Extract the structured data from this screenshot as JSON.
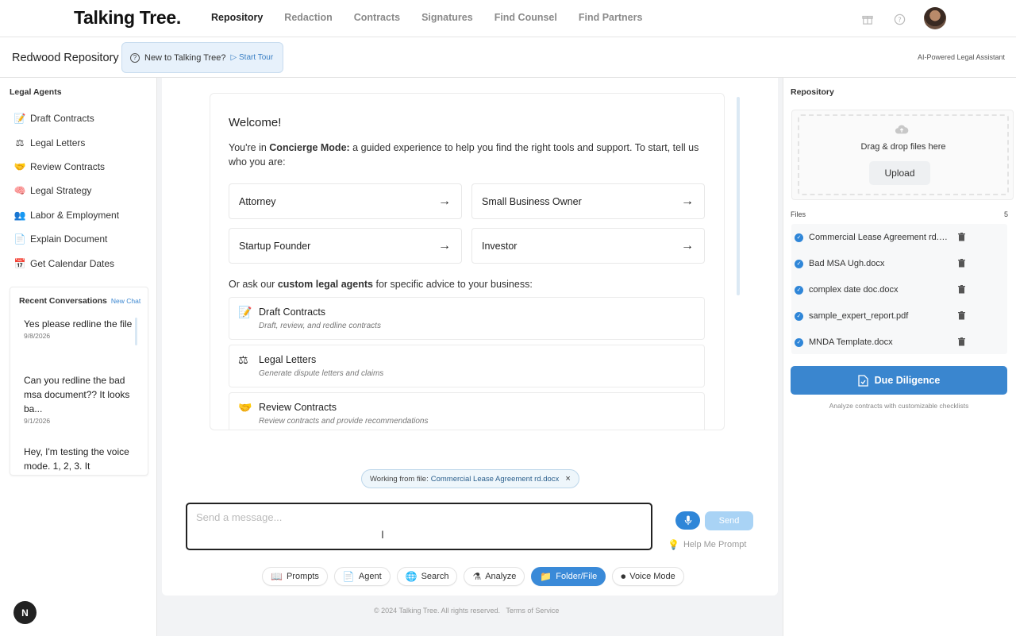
{
  "app": {
    "logo": "Talking Tree."
  },
  "nav": {
    "items": [
      {
        "label": "Repository",
        "active": true
      },
      {
        "label": "Redaction",
        "active": false
      },
      {
        "label": "Contracts",
        "active": false
      },
      {
        "label": "Signatures",
        "active": false
      },
      {
        "label": "Find Counsel",
        "active": false
      },
      {
        "label": "Find Partners",
        "active": false
      }
    ],
    "icons": [
      "gift-icon",
      "help-circle-icon",
      "user-avatar"
    ]
  },
  "subheader": {
    "title": "Redwood Repository",
    "tour_text": "New to Talking Tree?",
    "tour_link": "Start Tour",
    "assistant_label": "AI-Powered Legal Assistant"
  },
  "left": {
    "agents_title": "Legal Agents",
    "agents": [
      {
        "icon": "📝",
        "label": "Draft Contracts"
      },
      {
        "icon": "⚖",
        "label": "Legal Letters"
      },
      {
        "icon": "🤝",
        "label": "Review Contracts"
      },
      {
        "icon": "🧠",
        "label": "Legal Strategy"
      },
      {
        "icon": "👥",
        "label": "Labor & Employment"
      },
      {
        "icon": "📄",
        "label": "Explain Document"
      },
      {
        "icon": "📅",
        "label": "Get Calendar Dates"
      }
    ],
    "recent_title": "Recent Conversations",
    "new_chat": "New Chat",
    "conversations": [
      {
        "title": "Yes please redline the file",
        "date": "9/8/2026"
      },
      {
        "title": "Can you redline the bad msa document?? It looks ba...",
        "date": "9/1/2026"
      },
      {
        "title": "Hey, I'm testing the voice mode. 1, 2, 3. It",
        "date": ""
      }
    ]
  },
  "main": {
    "welcome_title": "Welcome!",
    "intro_prefix": "You're in ",
    "intro_mode": "Concierge Mode:",
    "intro_suffix": " a guided experience to help you find the right tools and support. To start, tell us who you are:",
    "roles": [
      "Attorney",
      "Small Business Owner",
      "Startup Founder",
      "Investor"
    ],
    "ask_prefix": "Or ask our ",
    "ask_bold": "custom legal agents",
    "ask_suffix": " for specific advice to your business:",
    "agent_cards": [
      {
        "icon": "📝",
        "name": "Draft Contracts",
        "desc": "Draft, review, and redline contracts"
      },
      {
        "icon": "⚖",
        "name": "Legal Letters",
        "desc": "Generate dispute letters and claims"
      },
      {
        "icon": "🤝",
        "name": "Review Contracts",
        "desc": "Review contracts and provide recommendations"
      }
    ],
    "working_prefix": "Working from file:",
    "working_file": "Commercial Lease Agreement rd.docx",
    "message_placeholder": "Send a message...",
    "send_label": "Send",
    "help_prompt": "Help Me Prompt",
    "tools": [
      {
        "icon": "📖",
        "label": "Prompts",
        "active": false
      },
      {
        "icon": "📄",
        "label": "Agent",
        "active": false
      },
      {
        "icon": "🌐",
        "label": "Search",
        "active": false
      },
      {
        "icon": "⚗",
        "label": "Analyze",
        "active": false
      },
      {
        "icon": "📁",
        "label": "Folder/File",
        "active": true
      },
      {
        "icon": "⏺",
        "label": "Voice Mode",
        "active": false
      }
    ],
    "copyright": "© 2024 Talking Tree. All rights reserved.",
    "terms": "Terms of Service"
  },
  "right": {
    "title": "Repository",
    "drag_text": "Drag & drop files here",
    "upload_label": "Upload",
    "files_label": "Files",
    "files_count": "5",
    "files": [
      "Commercial Lease Agreement rd.docx",
      "Bad MSA Ugh.docx",
      "complex date doc.docx",
      "sample_expert_report.pdf",
      "MNDA Template.docx"
    ],
    "dd_label": "Due Diligence",
    "dd_sub": "Analyze contracts with customizable checklists"
  },
  "footer_badge": "N",
  "colors": {
    "accent": "#3a86cf",
    "send_disabled": "#a9d3f5",
    "active_nav": "#222222"
  }
}
